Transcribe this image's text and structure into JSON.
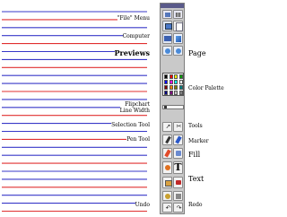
{
  "colors": {
    "background": "#ffffff",
    "line_blue": "#3838c8",
    "line_red": "#e03030",
    "toolbar_bg": "#c9c9c9",
    "toolbar_border": "#7d7d7d"
  },
  "ruled_lines": [
    "blue",
    "red",
    "blue",
    "blue",
    "red",
    "blue",
    "blue",
    "red",
    "blue",
    "blue",
    "red",
    "blue",
    "blue",
    "red",
    "blue",
    "blue",
    "red",
    "blue",
    "blue",
    "red",
    "blue",
    "blue",
    "red",
    "blue",
    "blue",
    "red"
  ],
  "left_labels": {
    "file_menu": "\"File\" Menu",
    "computer": "Computer",
    "previews": "Previews",
    "flipchart_line_width": "Flipchart\nLine Width",
    "selection_tool": "Selection Tool",
    "pen_tool": "Pen Tool",
    "undo": "Undo"
  },
  "right_labels": {
    "page": "Page",
    "color_palette": "Color Palette",
    "tools": "Tools",
    "marker": "Marker",
    "fill": "Fill",
    "text": "Text",
    "redo": "Redo"
  },
  "palette_colors": [
    "#000000",
    "#ff0000",
    "#ffff00",
    "#00a000",
    "#0000ff",
    "#ff00ff",
    "#00ffff",
    "#ffffff",
    "#800000",
    "#ff8000",
    "#808000",
    "#008080",
    "#000080",
    "#800080",
    "#c0c0c0",
    "#808080"
  ],
  "icons": {
    "file": "file-menu-icon",
    "computer": "computer-icon",
    "page": "page-icon",
    "previews": "previews-icon",
    "select": "selection-tool-icon",
    "pen": "pen-tool-icon",
    "marker": "marker-tool-icon",
    "fill": "fill-tool-icon",
    "text": "text-tool-icon",
    "undo": "undo-icon",
    "redo": "redo-icon"
  },
  "toolbar": {
    "text_glyph": "T"
  }
}
